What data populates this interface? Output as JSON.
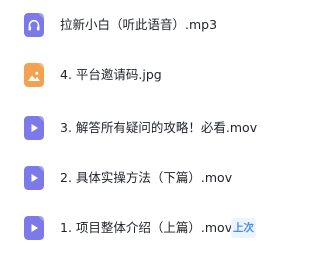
{
  "colors": {
    "text": "#1f2329",
    "audio": "#7b7ae8",
    "image": "#f3a251",
    "video": "#7b7ae8",
    "badge_text": "#4a8ef0",
    "badge_bg": "#eef4fe"
  },
  "files": [
    {
      "name": "拉新小白（听此语音）.mp3",
      "type": "audio",
      "icon": "headphones-icon"
    },
    {
      "name": "4. 平台邀请码.jpg",
      "type": "image",
      "icon": "image-icon"
    },
    {
      "name": "3. 解答所有疑问的攻略！必看.mov",
      "type": "video",
      "icon": "play-icon"
    },
    {
      "name": "2. 具体实操方法（下篇）.mov",
      "type": "video",
      "icon": "play-icon"
    },
    {
      "name": "1. 项目整体介绍（上篇）.mov",
      "type": "video",
      "icon": "play-icon",
      "badge": "上次"
    }
  ]
}
